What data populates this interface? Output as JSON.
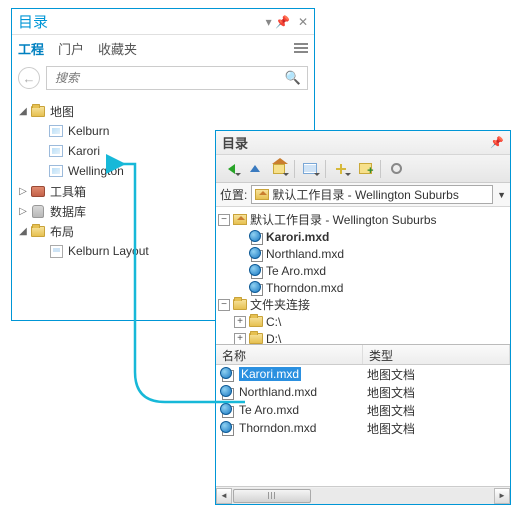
{
  "left": {
    "title": "目录",
    "tabs": {
      "project": "工程",
      "portal": "门户",
      "favorites": "收藏夹"
    },
    "search_placeholder": "搜索",
    "sections": {
      "maps": "地图",
      "toolboxes": "工具箱",
      "databases": "数据库",
      "layouts": "布局"
    },
    "map_items": [
      "Kelburn",
      "Karori",
      "Wellington"
    ],
    "layout_items": [
      "Kelburn Layout"
    ]
  },
  "right": {
    "title": "目录",
    "location_label": "位置:",
    "location_value": "默认工作目录 - Wellington Suburbs",
    "tree": {
      "root": "默认工作目录 - Wellington Suburbs",
      "mxds": [
        "Karori.mxd",
        "Northland.mxd",
        "Te Aro.mxd",
        "Thorndon.mxd"
      ],
      "folder_conn": "文件夹连接",
      "drives": [
        "C:\\",
        "D:\\"
      ]
    },
    "list": {
      "col_name": "名称",
      "col_type": "类型",
      "rows": [
        {
          "name": "Karori.mxd",
          "type": "地图文档",
          "selected": true
        },
        {
          "name": "Northland.mxd",
          "type": "地图文档",
          "selected": false
        },
        {
          "name": "Te Aro.mxd",
          "type": "地图文档",
          "selected": false
        },
        {
          "name": "Thorndon.mxd",
          "type": "地图文档",
          "selected": false
        }
      ]
    }
  }
}
